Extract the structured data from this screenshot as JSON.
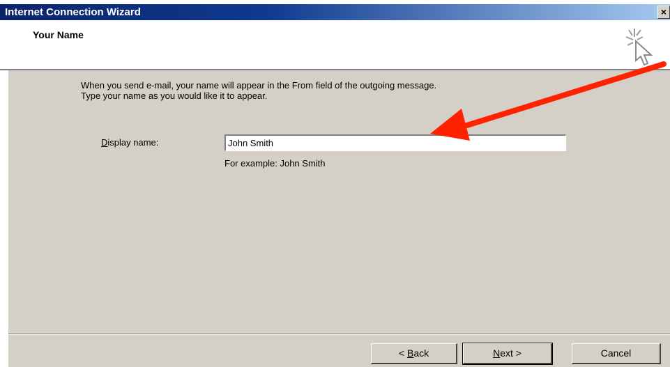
{
  "window": {
    "title": "Internet Connection Wizard",
    "close_glyph": "×"
  },
  "header": {
    "title": "Your Name",
    "icon": "cursor-sparkle-icon"
  },
  "body": {
    "intro_line1": "When you send e-mail, your name will appear in the From field of the outgoing message.",
    "intro_line2": "Type your name as you would like it to appear.",
    "display_name_label_accel": "D",
    "display_name_label_rest": "isplay name:",
    "display_name_value": "John Smith",
    "example_text": "For example: John Smith"
  },
  "buttons": {
    "back_prefix": "< ",
    "back_accel": "B",
    "back_rest": "ack",
    "next_accel": "N",
    "next_rest": "ext >",
    "cancel": "Cancel"
  },
  "annotation": {
    "arrow_color": "#ff2200"
  }
}
